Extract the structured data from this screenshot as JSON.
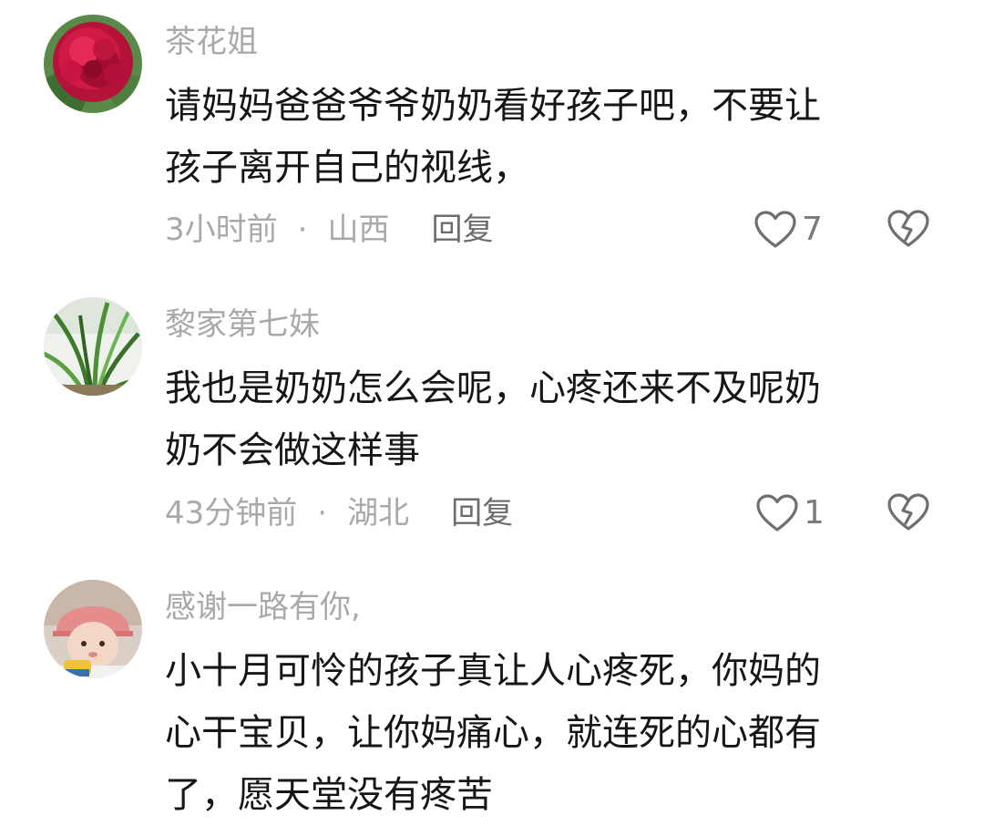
{
  "comments": [
    {
      "username": "茶花姐",
      "text_lines": [
        "请妈妈爸爸爷爷奶奶看好孩子吧，不要让",
        "孩子离开自己的视线，"
      ],
      "time": "3小时前",
      "location": "山西",
      "reply_label": "回复",
      "likes": "7",
      "avatar": "red-peony-flower"
    },
    {
      "username": "黎家第七妹",
      "text_lines": [
        "我也是奶奶怎么会呢，心疼还来不及呢奶",
        "奶不会做这样事"
      ],
      "time": "43分钟前",
      "location": "湖北",
      "reply_label": "回复",
      "likes": "1",
      "avatar": "green-plant"
    },
    {
      "username": "感谢一路有你,",
      "text_lines": [
        "小十月可怜的孩子真让人心疼死，你妈的",
        "心干宝贝，让你妈痛心，就连死的心都有",
        "了，愿天堂没有疼苦"
      ],
      "avatar": "baby-in-pink-hat"
    }
  ],
  "meta_separator": "·",
  "icons": {
    "like": "heart-outline-icon",
    "dislike": "broken-heart-icon"
  },
  "colors": {
    "username": "#a9a9a9",
    "body_text": "#161616",
    "reply": "#6c6c6c",
    "icon_stroke": "#6f6f6f"
  }
}
